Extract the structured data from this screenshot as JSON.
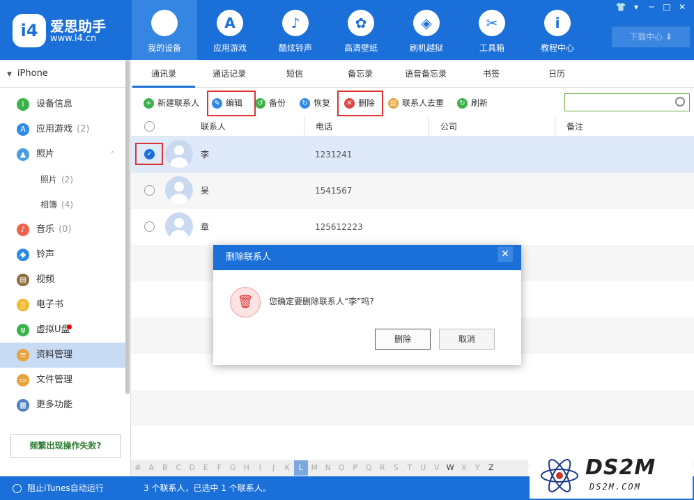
{
  "window_controls": [
    "👕",
    "▾",
    "─",
    "□",
    "✕"
  ],
  "logo": {
    "badge": "i4",
    "name": "爱思助手",
    "url": "www.i4.cn"
  },
  "nav": [
    {
      "label": "我的设备",
      "icon": "apple-icon",
      "glyph": "",
      "active": true
    },
    {
      "label": "应用游戏",
      "icon": "app-store-icon",
      "glyph": "A",
      "active": false
    },
    {
      "label": "酷炫铃声",
      "icon": "bell-icon",
      "glyph": "♪",
      "active": false
    },
    {
      "label": "高清壁纸",
      "icon": "flower-icon",
      "glyph": "✿",
      "active": false
    },
    {
      "label": "刷机越狱",
      "icon": "dropbox-icon",
      "glyph": "◈",
      "active": false
    },
    {
      "label": "工具箱",
      "icon": "tools-icon",
      "glyph": "✂",
      "active": false
    },
    {
      "label": "教程中心",
      "icon": "info-icon",
      "glyph": "i",
      "active": false
    }
  ],
  "download": {
    "label": "下载中心 ⬇"
  },
  "sidebar": {
    "device": "iPhone",
    "items": [
      {
        "label": "设备信息",
        "count": "",
        "color": "#3bb34a",
        "glyph": "i",
        "icon": "info-icon"
      },
      {
        "label": "应用游戏",
        "count": "(2)",
        "color": "#2f8be6",
        "glyph": "A",
        "icon": "app-store-icon"
      },
      {
        "label": "照片",
        "count": "",
        "color": "#4a9de0",
        "glyph": "▲",
        "icon": "photo-icon"
      },
      {
        "label": "音乐",
        "count": "(0)",
        "color": "#f0604a",
        "glyph": "♪",
        "icon": "music-icon"
      },
      {
        "label": "铃声",
        "count": "",
        "color": "#2f8be6",
        "glyph": "◆",
        "icon": "bell-icon"
      },
      {
        "label": "视频",
        "count": "",
        "color": "#8b6b3d",
        "glyph": "▤",
        "icon": "video-icon"
      },
      {
        "label": "电子书",
        "count": "",
        "color": "#f2b933",
        "glyph": "▯",
        "icon": "book-icon"
      },
      {
        "label": "虚拟U盘",
        "count": "",
        "color": "#3bb34a",
        "glyph": "ψ",
        "icon": "usb-icon"
      },
      {
        "label": "资料管理",
        "count": "",
        "color": "#e8a33a",
        "glyph": "≡",
        "icon": "file-list-icon"
      },
      {
        "label": "文件管理",
        "count": "",
        "color": "#e8a33a",
        "glyph": "▭",
        "icon": "folder-icon"
      },
      {
        "label": "更多功能",
        "count": "",
        "color": "#4a7cc0",
        "glyph": "▦",
        "icon": "grid-icon"
      }
    ],
    "photo_subs": [
      {
        "label": "照片",
        "count": "(2)"
      },
      {
        "label": "相簿",
        "count": "(4)"
      }
    ],
    "help_button": "频繁出现操作失败?"
  },
  "tabs": [
    "通讯录",
    "通话记录",
    "短信",
    "备忘录",
    "语音备忘录",
    "书签",
    "日历"
  ],
  "toolbar": [
    {
      "label": "新建联系人",
      "icon": "plus-icon",
      "color": "#3bb34a",
      "glyph": "+"
    },
    {
      "label": "编辑",
      "icon": "edit-icon",
      "color": "#2f8be6",
      "glyph": "✎"
    },
    {
      "label": "备份",
      "icon": "backup-icon",
      "color": "#3bb34a",
      "glyph": "↺"
    },
    {
      "label": "恢复",
      "icon": "restore-icon",
      "color": "#2f8be6",
      "glyph": "↻"
    },
    {
      "label": "删除",
      "icon": "delete-icon",
      "color": "#e04848",
      "glyph": "✕"
    },
    {
      "label": "联系人去重",
      "icon": "dedupe-icon",
      "color": "#e8a33a",
      "glyph": "▤"
    },
    {
      "label": "刷新",
      "icon": "refresh-icon",
      "color": "#3bb34a",
      "glyph": "↻"
    }
  ],
  "search": {
    "placeholder": ""
  },
  "table": {
    "headers": [
      "联系人",
      "电话",
      "公司",
      "备注"
    ],
    "rows": [
      {
        "name": "李",
        "phone": "1231241",
        "selected": true
      },
      {
        "name": "吴",
        "phone": "1541567",
        "selected": false
      },
      {
        "name": "章",
        "phone": "125612223",
        "selected": false
      }
    ]
  },
  "alphabet": [
    "#",
    "A",
    "B",
    "C",
    "D",
    "E",
    "F",
    "G",
    "H",
    "I",
    "J",
    "K",
    "L",
    "M",
    "N",
    "O",
    "P",
    "Q",
    "R",
    "S",
    "T",
    "U",
    "V",
    "W",
    "X",
    "Y",
    "Z"
  ],
  "alphabet_active": "L",
  "alphabet_dark": [
    "W",
    "Z"
  ],
  "status": {
    "left": "阻止iTunes自动运行",
    "message": "3 个联系人，已选中 1 个联系人。"
  },
  "watermark": {
    "big": "DS2M",
    "small": "DS2M.COM"
  },
  "dialog": {
    "title": "删除联系人",
    "message": "您确定要删除联系人“李”吗?",
    "confirm": "删除",
    "cancel": "取消",
    "close": "✕"
  },
  "colors": {
    "primary": "#1a6fd8",
    "selection": "#deeafa",
    "highlight": "#d33"
  }
}
